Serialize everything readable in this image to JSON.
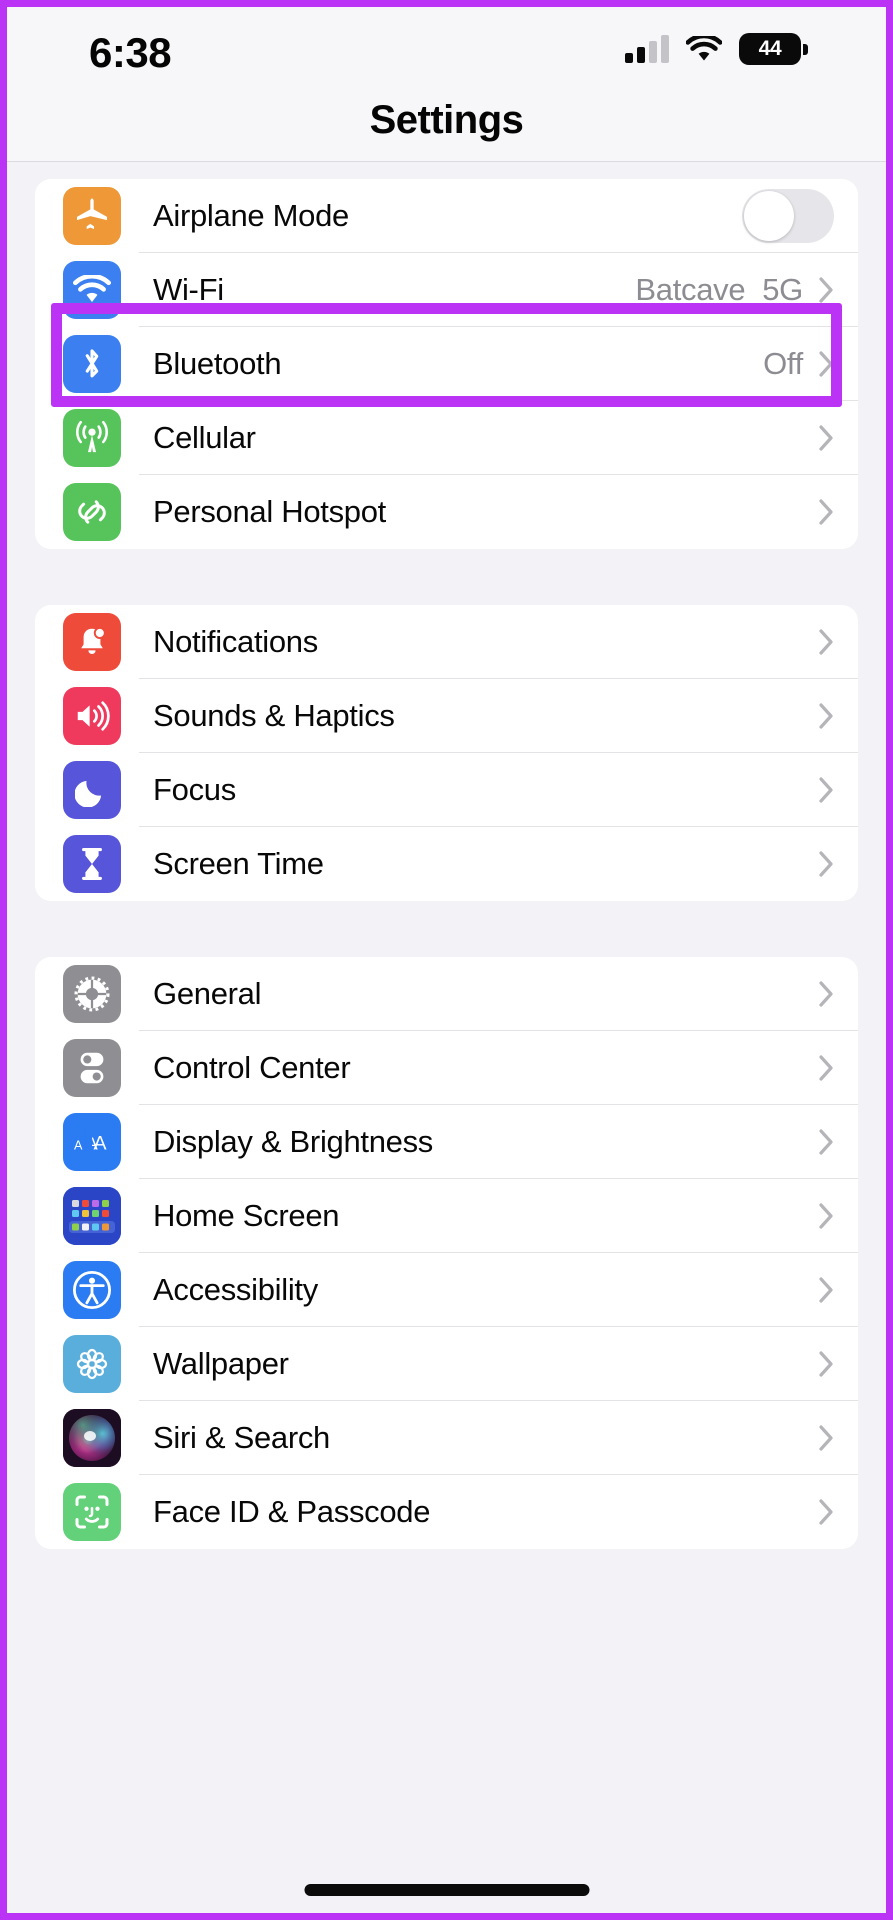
{
  "frame": {
    "accent_color": "#bb33f5"
  },
  "status_bar": {
    "time": "6:38",
    "signal_icon": "cellular-signal-icon",
    "signal_bars_filled": 2,
    "signal_bars_total": 4,
    "wifi_icon": "wifi-icon",
    "battery_level": "44",
    "battery_icon": "battery-icon"
  },
  "nav": {
    "title": "Settings"
  },
  "groups": [
    {
      "id": "connectivity",
      "rows": [
        {
          "label": "Airplane Mode",
          "icon": "airplane-icon",
          "icon_color": "#ef9838",
          "control": "toggle",
          "toggle_on": false,
          "value": ""
        },
        {
          "label": "Wi-Fi",
          "icon": "wifi-icon",
          "icon_color": "#3b7ff0",
          "control": "chevron",
          "value": "Batcave_5G",
          "highlighted": true
        },
        {
          "label": "Bluetooth",
          "icon": "bluetooth-icon",
          "icon_color": "#3b7ff0",
          "control": "chevron",
          "value": "Off"
        },
        {
          "label": "Cellular",
          "icon": "cellular-antenna-icon",
          "icon_color": "#56c45a",
          "control": "chevron",
          "value": ""
        },
        {
          "label": "Personal Hotspot",
          "icon": "personal-hotspot-icon",
          "icon_color": "#56c45a",
          "control": "chevron",
          "value": ""
        }
      ]
    },
    {
      "id": "alerts",
      "rows": [
        {
          "label": "Notifications",
          "icon": "bell-icon",
          "icon_color": "#ee4b3a",
          "control": "chevron",
          "value": ""
        },
        {
          "label": "Sounds & Haptics",
          "icon": "speaker-icon",
          "icon_color": "#ef3a5e",
          "control": "chevron",
          "value": ""
        },
        {
          "label": "Focus",
          "icon": "moon-icon",
          "icon_color": "#5755d9",
          "control": "chevron",
          "value": ""
        },
        {
          "label": "Screen Time",
          "icon": "hourglass-icon",
          "icon_color": "#5755d9",
          "control": "chevron",
          "value": ""
        }
      ]
    },
    {
      "id": "system",
      "rows": [
        {
          "label": "General",
          "icon": "gear-icon",
          "icon_color": "#8e8e93",
          "control": "chevron",
          "value": ""
        },
        {
          "label": "Control Center",
          "icon": "control-center-icon",
          "icon_color": "#8e8e93",
          "control": "chevron",
          "value": ""
        },
        {
          "label": "Display & Brightness",
          "icon": "display-brightness-icon",
          "icon_color": "#2b7bf3",
          "control": "chevron",
          "value": ""
        },
        {
          "label": "Home Screen",
          "icon": "home-screen-icon",
          "icon_color": "#2a46c6",
          "control": "chevron",
          "value": ""
        },
        {
          "label": "Accessibility",
          "icon": "accessibility-icon",
          "icon_color": "#2b7bf3",
          "control": "chevron",
          "value": ""
        },
        {
          "label": "Wallpaper",
          "icon": "wallpaper-flower-icon",
          "icon_color": "#5aaedc",
          "control": "chevron",
          "value": ""
        },
        {
          "label": "Siri & Search",
          "icon": "siri-orb-icon",
          "icon_color": "#2a1430",
          "control": "chevron",
          "value": ""
        },
        {
          "label": "Face ID & Passcode",
          "icon": "face-id-icon",
          "icon_color": "#63d07a",
          "control": "chevron",
          "value": ""
        }
      ]
    }
  ]
}
